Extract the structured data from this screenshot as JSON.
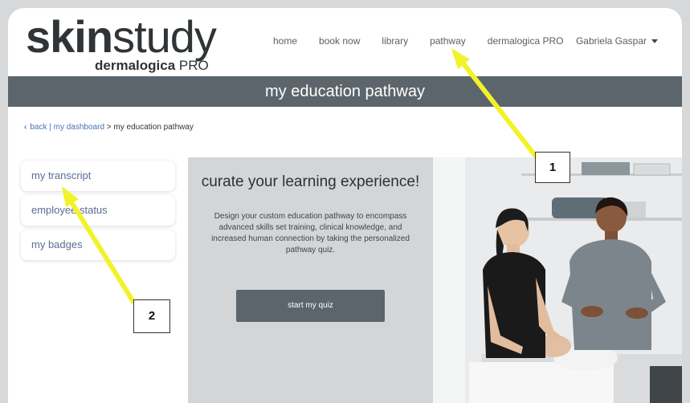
{
  "brand": {
    "logo_bold": "skin",
    "logo_light": "study",
    "sub_bold": "dermalogica",
    "sub_light": "PRO"
  },
  "nav": {
    "items": [
      "home",
      "book now",
      "library",
      "pathway",
      "dermalogica PRO"
    ]
  },
  "user": {
    "name": "Gabriela Gaspar"
  },
  "banner": {
    "title": "my education pathway"
  },
  "breadcrumb": {
    "back": "back",
    "dashboard": "my dashboard",
    "current": "> my education pathway"
  },
  "sidebar": {
    "items": [
      {
        "label": "my transcript"
      },
      {
        "label": "employee status"
      },
      {
        "label": "my badges"
      }
    ]
  },
  "promo": {
    "heading": "curate your learning experience!",
    "body": "Design your custom education pathway to encompass advanced skills set training, clinical knowledge, and increased human connection by taking the personalized pathway quiz.",
    "button": "start my quiz"
  },
  "callouts": [
    "1",
    "2"
  ],
  "colors": {
    "banner": "#5c656b",
    "arrow": "#f2f22a",
    "link": "#4a72b7"
  }
}
